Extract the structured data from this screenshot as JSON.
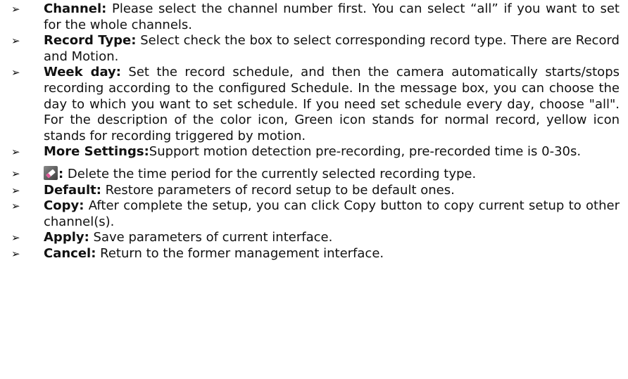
{
  "items": [
    {
      "term": "Channel:",
      "text": " Please select the channel number first. You can select “all” if you want to set for the whole channels."
    },
    {
      "term": "Record Type:",
      "text": " Select check the box to select corresponding record type. There are Record and Motion."
    },
    {
      "term": "Week day:",
      "text": " Set the record schedule, and then the camera automatically starts/stops recording according to the configured Schedule. In the message box, you can choose the day to which you want to set schedule. If you need set schedule every day, choose \"all\". For the description of the color icon, Green icon stands for normal record, yellow icon stands for recording triggered by motion."
    },
    {
      "term": "More Settings:",
      "text": "Support motion detection pre-recording, pre-recorded time is 0-30s."
    },
    {
      "term": ":",
      "icon": "eraser-icon",
      "text": " Delete the time period for the currently selected recording type."
    },
    {
      "term": "Default:",
      "text": " Restore parameters of record setup to be default ones."
    },
    {
      "term": "Copy:",
      "text": " After complete the setup, you can click Copy button to copy current setup to other channel(s)."
    },
    {
      "term": "Apply:",
      "text": " Save parameters of current interface."
    },
    {
      "term": "Cancel:",
      "text": " Return to the former management interface."
    }
  ],
  "bullet_glyph": "➢"
}
